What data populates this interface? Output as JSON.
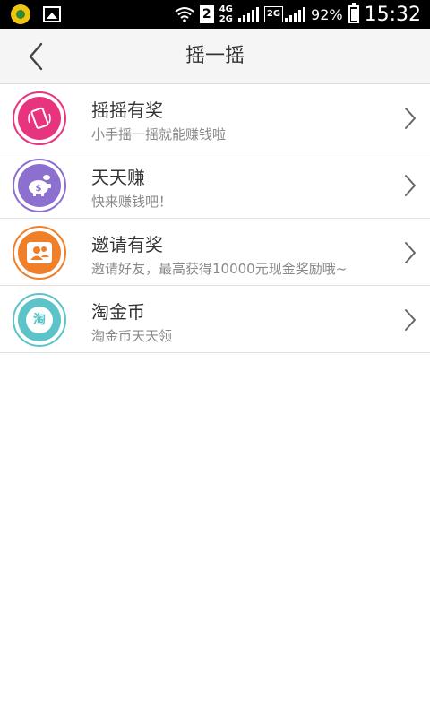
{
  "status_bar": {
    "sim_slot": "2",
    "network_top": "4G",
    "network_bottom": "2G",
    "network_2g_box": "2G",
    "battery_percent": "92%",
    "time": "15:32"
  },
  "header": {
    "title": "摇一摇",
    "back_icon": "chevron-left-icon"
  },
  "items": [
    {
      "title": "摇摇有奖",
      "subtitle": "小手摇一摇就能赚钱啦",
      "icon": "phone-shake-icon",
      "color": "#e8347e"
    },
    {
      "title": "天天赚",
      "subtitle": "快来赚钱吧！",
      "icon": "piggy-bank-icon",
      "color": "#8c6fcf"
    },
    {
      "title": "邀请有奖",
      "subtitle": "邀请好友，最高获得10000元现金奖励哦~",
      "icon": "invite-users-icon",
      "color": "#f07f2a"
    },
    {
      "title": "淘金币",
      "subtitle": "淘金币天天领",
      "icon": "taobao-coin-icon",
      "icon_text": "淘",
      "color": "#5cc3c9"
    }
  ]
}
